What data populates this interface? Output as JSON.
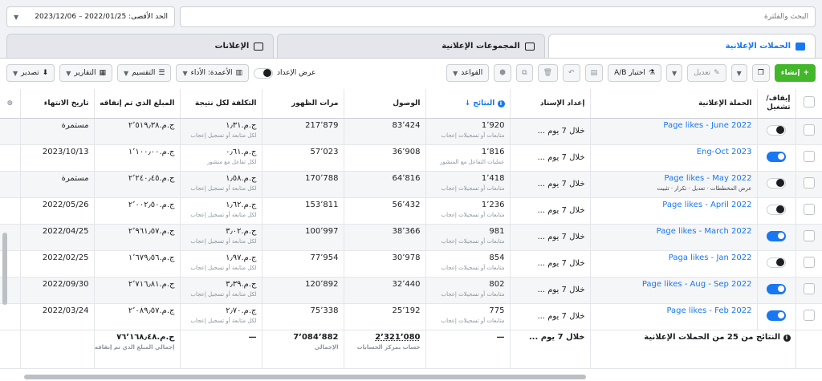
{
  "search": {
    "placeholder": "البحث والفلترة"
  },
  "date_range": {
    "label": "الحد الأقصى: 2022/01/25 – 2023/12/06"
  },
  "tabs": [
    {
      "label": "الحملات الإعلانية"
    },
    {
      "label": "المجموعات الإعلانية"
    },
    {
      "label": "الإعلانات"
    }
  ],
  "toolbar": {
    "create": "إنشاء",
    "edit": "تعديل",
    "ab_test": "اختبار A/B",
    "rules": "القواعد",
    "view_setup": "عرض الإعداد",
    "columns": "الأعمدة: الأداء",
    "breakdown": "التقسيم",
    "reports": "التقارير",
    "export": "تصدير"
  },
  "headers": {
    "toggle": "إيقاف/ تشغيل",
    "campaign": "الحملة الإعلانية",
    "attribution": "إعداد الإسناد",
    "results": "النتائج",
    "reach": "الوصول",
    "impressions": "مرات الظهور",
    "cost": "التكلفة لكل نتيجة",
    "spent": "المبلغ الذي تم إنفاقه",
    "end": "تاريخ الانتهاء"
  },
  "row_meta": {
    "edit": "تعديل",
    "duplicate": "تكرار",
    "pin": "تثبيت",
    "charts": "عرض المخططات"
  },
  "rows": [
    {
      "name": "Page likes - June 2022",
      "on": false,
      "attribution": "خلال 7 يوم ...",
      "results": "1٬920",
      "results_sub": "متابعات أو تسجيلات إعجاب",
      "reach": "83٬424",
      "impressions": "217٬879",
      "cost": "ج.م.١٫٣١",
      "cost_sub": "لكل متابعة أو تسجيل إعجاب",
      "spent": "ج.م.٢٬٥١٩٫٣٨",
      "end": "مستمرة"
    },
    {
      "name": "Eng-Oct 2023",
      "on": true,
      "attribution": "خلال 7 يوم ...",
      "results": "1٬816",
      "results_sub": "عمليات التفاعل مع المنشور",
      "reach": "36٬908",
      "impressions": "57٬023",
      "cost": "ج.م.٠٫٦١",
      "cost_sub": "لكل تفاعل مع منشور",
      "spent": "ج.م.١٬١٠٠٫٠٠",
      "end": "2023/10/13"
    },
    {
      "name": "Page likes - May 2022",
      "on": false,
      "attribution": "خلال 7 يوم ...",
      "results": "1٬418",
      "results_sub": "متابعات أو تسجيلات إعجاب",
      "reach": "64٬816",
      "impressions": "170٬788",
      "cost": "ج.م.١٫٥٨",
      "cost_sub": "لكل متابعة أو تسجيل إعجاب",
      "spent": "ج.م.٢٬٢٤٠٫٤٥",
      "end": "مستمرة",
      "hover": true
    },
    {
      "name": "Page likes - April 2022",
      "on": false,
      "attribution": "خلال 7 يوم ...",
      "results": "1٬236",
      "results_sub": "متابعات أو تسجيلات إعجاب",
      "reach": "56٬432",
      "impressions": "153٬811",
      "cost": "ج.م.١٫٦٢",
      "cost_sub": "لكل متابعة أو تسجيل إعجاب",
      "spent": "ج.م.٢٬٠٠٢٫٥٠",
      "end": "2022/05/26"
    },
    {
      "name": "Page likes - March 2022",
      "on": true,
      "attribution": "خلال 7 يوم ...",
      "results": "981",
      "results_sub": "متابعات أو تسجيلات إعجاب",
      "reach": "38٬366",
      "impressions": "100٬997",
      "cost": "ج.م.٣٫٠٢",
      "cost_sub": "لكل متابعة أو تسجيل إعجاب",
      "spent": "ج.م.٢٬٩٦١٫٥٧",
      "end": "2022/04/25"
    },
    {
      "name": "Paga likes - Jan 2022",
      "on": false,
      "attribution": "خلال 7 يوم ...",
      "results": "854",
      "results_sub": "متابعات أو تسجيلات إعجاب",
      "reach": "30٬978",
      "impressions": "77٬954",
      "cost": "ج.م.١٫٩٧",
      "cost_sub": "لكل متابعة أو تسجيل إعجاب",
      "spent": "ج.م.١٬٦٧٩٫٥٦",
      "end": "2022/02/25"
    },
    {
      "name": "Page likes - Aug - Sep 2022",
      "on": true,
      "attribution": "خلال 7 يوم ...",
      "results": "802",
      "results_sub": "متابعات أو تسجيلات إعجاب",
      "reach": "32٬440",
      "impressions": "120٬892",
      "cost": "ج.م.٣٫٣٩",
      "cost_sub": "لكل متابعة أو تسجيل إعجاب",
      "spent": "ج.م.٢٬٧١٦٫٨١",
      "end": "2022/09/30"
    },
    {
      "name": "Page likes - Feb 2022",
      "on": true,
      "attribution": "خلال 7 يوم ...",
      "results": "775",
      "results_sub": "متابعات أو تسجيلات إعجاب",
      "reach": "25٬192",
      "impressions": "75٬338",
      "cost": "ج.م.٢٫٧٠",
      "cost_sub": "لكل متابعة أو تسجيل إعجاب",
      "spent": "ج.م.٢٬٠٨٩٫٥٧",
      "end": "2022/03/24"
    }
  ],
  "totals": {
    "label": "النتائج من 25 من الحملات الإعلانية",
    "attribution": "خلال 7 يوم ...",
    "results": "—",
    "reach": "2٬321٬080",
    "reach_sub": "حساب بمركز الحسابات",
    "impressions": "7٬084٬882",
    "impressions_sub": "الإجمالي",
    "cost": "—",
    "spent": "ج.م.٧٦٬١٦٨٫٤٨",
    "spent_sub": "إجمالي المبلغ الذي تم إنفاقه",
    "end": ""
  }
}
